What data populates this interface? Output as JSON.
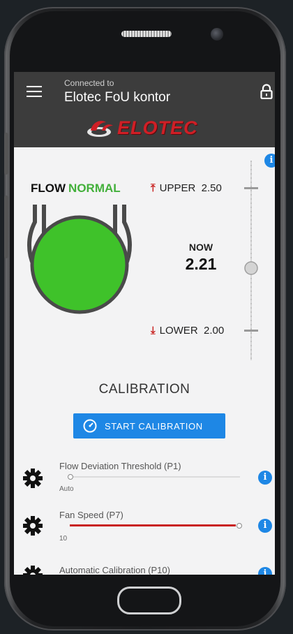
{
  "header": {
    "connected_label": "Connected to",
    "device_name": "Elotec FoU kontor",
    "logo_text": "ELOTEC"
  },
  "flow": {
    "label": "FLOW",
    "status": "NORMAL",
    "upper_label": "UPPER",
    "upper_value": "2.50",
    "now_label": "NOW",
    "now_value": "2.21",
    "lower_label": "LOWER",
    "lower_value": "2.00",
    "status_color": "#43b03b"
  },
  "calibration": {
    "title": "CALIBRATION",
    "button_label": "START CALIBRATION"
  },
  "parameters": [
    {
      "name": "Flow Deviation Threshold (P1)",
      "value": "Auto"
    },
    {
      "name": "Fan Speed (P7)",
      "value": "10"
    },
    {
      "name": "Automatic Calibration (P10)",
      "value": ""
    }
  ],
  "colors": {
    "accent": "#1e87e5",
    "appbar": "#3c3c3c",
    "alert_red": "#c8211f",
    "brand_red": "#d01f26"
  }
}
